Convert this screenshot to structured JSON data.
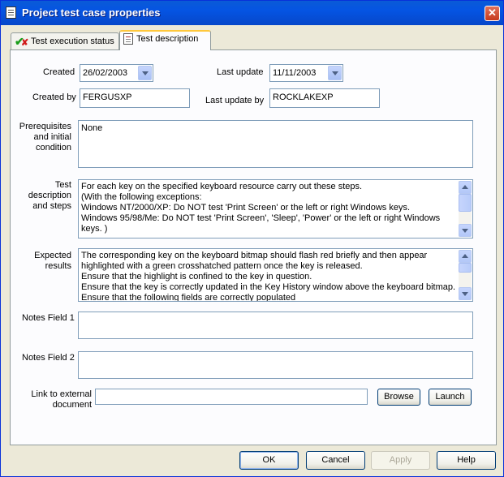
{
  "window": {
    "title": "Project test case properties",
    "close_glyph": "✕"
  },
  "tabs": [
    {
      "label": "Test execution status",
      "icon": "check-cross-icon"
    },
    {
      "label": "Test description",
      "icon": "document-icon",
      "active": true
    }
  ],
  "form": {
    "created_label": "Created",
    "created_value": "26/02/2003",
    "last_update_label": "Last update",
    "last_update_value": "11/11/2003",
    "created_by_label": "Created by",
    "created_by_value": "FERGUSXP",
    "last_update_by_label": "Last update by",
    "last_update_by_value": "ROCKLAKEXP",
    "prereq_label_lines": [
      "Prerequisites",
      "and initial",
      "condition"
    ],
    "prereq_value": "None",
    "test_desc_label_lines": [
      "Test",
      "description",
      "and steps"
    ],
    "test_desc_lines": [
      "For each key on the specified keyboard resource carry out these steps.",
      " (With the following exceptions:",
      "   Windows NT/2000/XP: Do NOT test 'Print Screen' or the left or right Windows keys.",
      "   Windows 95/98/Me: Do NOT test 'Print Screen', 'Sleep', 'Power' or the left or right Windows",
      "keys. )"
    ],
    "expected_label_lines": [
      "Expected",
      "results"
    ],
    "expected_lines": [
      "The corresponding key on the keyboard bitmap should flash red briefly and then appear",
      "highlighted with a green crosshatched pattern once the key is released.",
      "Ensure that the highlight is confined to the key in question.",
      "Ensure that the key is correctly updated in the Key History window above the keyboard bitmap.",
      "Ensure that the following fields are correctly populated"
    ],
    "notes1_label": "Notes Field 1",
    "notes1_value": "",
    "notes2_label": "Notes Field 2",
    "notes2_value": "",
    "link_label_lines": [
      "Link to external",
      "document"
    ],
    "link_value": "",
    "browse_label": "Browse",
    "launch_label": "Launch"
  },
  "footer": {
    "ok_label": "OK",
    "cancel_label": "Cancel",
    "apply_label": "Apply",
    "help_label": "Help"
  }
}
